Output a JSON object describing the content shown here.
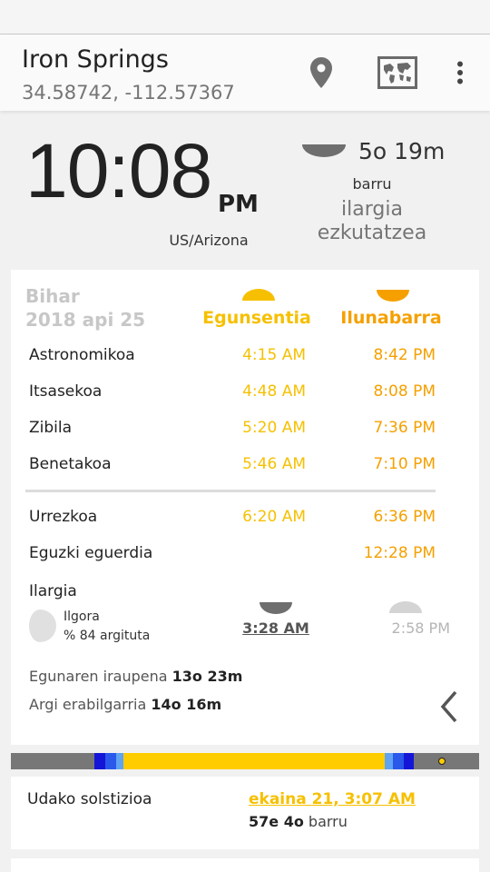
{
  "location": {
    "name": "Iron Springs",
    "coordinates": "34.58742, -112.57367"
  },
  "toolbar": {
    "icons": [
      "location-pin-icon",
      "world-map-icon",
      "more-vert-icon"
    ]
  },
  "clock": {
    "time": "10:08",
    "ampm": "PM",
    "timezone": "US/Arizona"
  },
  "next_event": {
    "in": "5o 19m",
    "suffix": "barru",
    "name": "ilargia ezkutatzea",
    "icon": "moon-set-icon"
  },
  "day": {
    "label": "Bihar",
    "date": "2018 api 25"
  },
  "columns": {
    "dawn": "Egunsentia",
    "dusk": "Ilunabarra"
  },
  "twilight_rows": [
    {
      "label": "Astronomikoa",
      "dawn": "4:15 AM",
      "dusk": "8:42 PM"
    },
    {
      "label": "Itsasekoa",
      "dawn": "4:48 AM",
      "dusk": "8:08 PM"
    },
    {
      "label": "Zibila",
      "dawn": "5:20 AM",
      "dusk": "7:36 PM"
    },
    {
      "label": "Benetakoa",
      "dawn": "5:46 AM",
      "dusk": "7:10 PM"
    }
  ],
  "extra_rows": [
    {
      "label": "Urrezkoa",
      "dawn": "6:20 AM",
      "dusk": "6:36 PM"
    },
    {
      "label": "Eguzki eguerdia",
      "dawn": "",
      "dusk": "12:28 PM"
    }
  ],
  "moon": {
    "label": "Ilargia",
    "direction": "Ilgora",
    "illumination": "% 84 argituta",
    "rise": "3:28 AM",
    "set": "2:58 PM"
  },
  "stats": {
    "day_length_label": "Egunaren iraupena",
    "day_length": "13o 23m",
    "usable_light_label": "Argi erabilgarria",
    "usable_light": "14o 16m"
  },
  "solstice": {
    "label": "Udako solstizioa",
    "date": "ekaina 21, 3:07 AM",
    "remaining": "57e 4o",
    "remaining_suffix": "barru"
  },
  "colors": {
    "dawn": "#f6c000",
    "dusk": "#f5a000",
    "night": "#777777",
    "astronomical": "#1515d8",
    "civil": "#5fa3f2",
    "day": "#ffcc00"
  }
}
